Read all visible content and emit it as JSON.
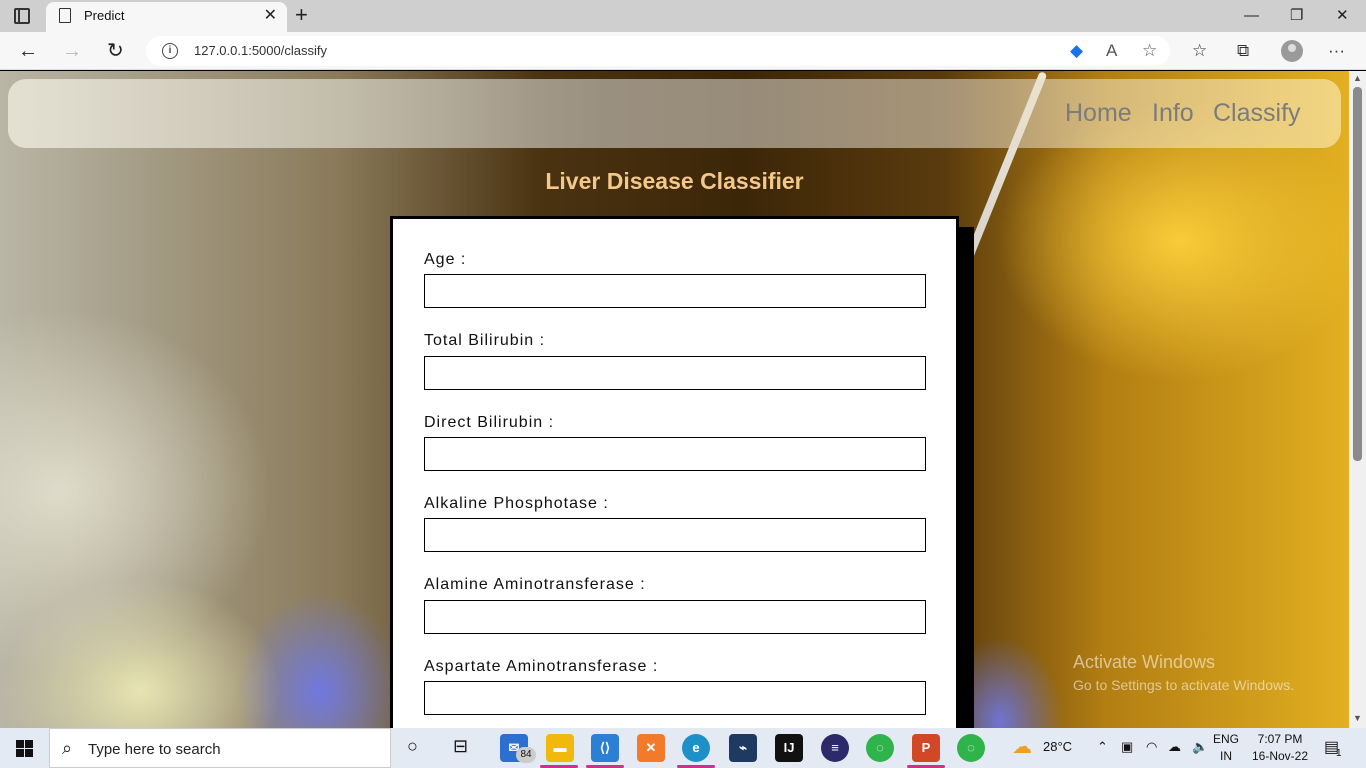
{
  "browser": {
    "tab_title": "Predict",
    "tab_close": "✕",
    "new_tab": "+",
    "minimize": "—",
    "restore": "❐",
    "close": "✕",
    "back": "←",
    "forward": "→",
    "reload": "↻",
    "url": "127.0.0.1:5000/classify",
    "info": "i",
    "more": "···"
  },
  "navbar": {
    "links": [
      "Home",
      "Info",
      "Classify"
    ]
  },
  "page": {
    "title": "Liver Disease Classifier",
    "fields": [
      {
        "label": "Age :",
        "value": ""
      },
      {
        "label": "Total Bilirubin :",
        "value": ""
      },
      {
        "label": "Direct Bilirubin :",
        "value": ""
      },
      {
        "label": "Alkaline Phosphotase :",
        "value": ""
      },
      {
        "label": "Alamine Aminotransferase :",
        "value": ""
      },
      {
        "label": "Aspartate Aminotransferase :",
        "value": ""
      }
    ]
  },
  "watermark": {
    "line1": "Activate Windows",
    "line2": "Go to Settings to activate Windows."
  },
  "taskbar": {
    "search_placeholder": "Type here to search",
    "mail_badge": "84",
    "weather": "28°C",
    "lang1": "ENG",
    "lang2": "IN",
    "time": "7:07 PM",
    "date": "16-Nov-22",
    "notif_count": "1"
  }
}
